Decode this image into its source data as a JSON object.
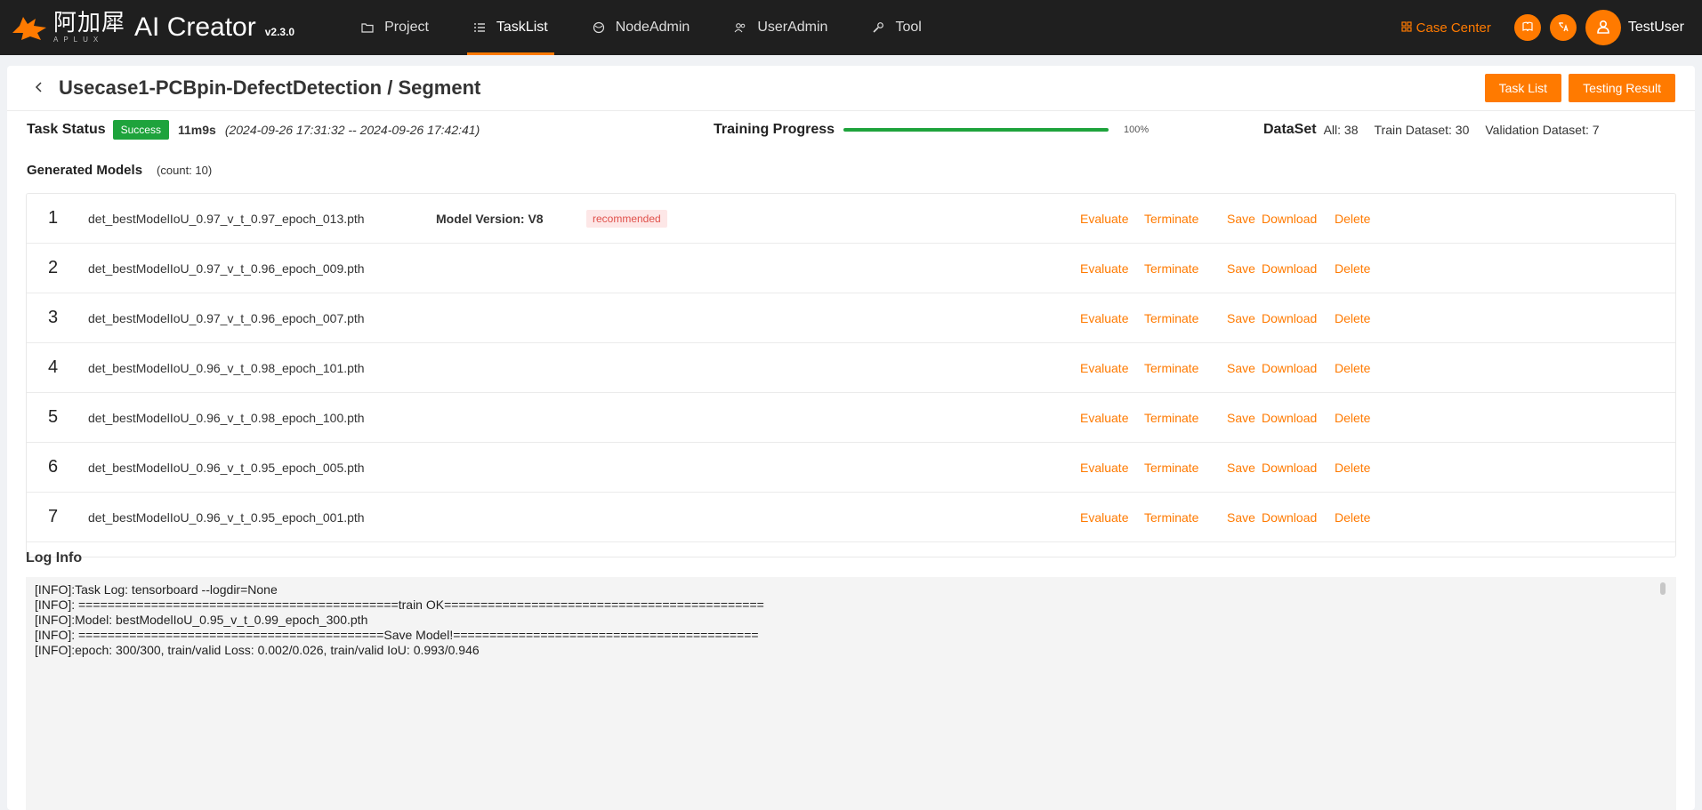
{
  "app": {
    "brand_cn": "阿加犀",
    "brand_en": "APLUX",
    "brand_name": "AI Creator",
    "version": "v2.3.0"
  },
  "nav": [
    {
      "label": "Project",
      "icon": "folder-icon",
      "active": false
    },
    {
      "label": "TaskList",
      "icon": "list-icon",
      "active": true
    },
    {
      "label": "NodeAdmin",
      "icon": "globe-icon",
      "active": false
    },
    {
      "label": "UserAdmin",
      "icon": "users-icon",
      "active": false
    },
    {
      "label": "Tool",
      "icon": "wrench-icon",
      "active": false
    }
  ],
  "topright": {
    "case_center": "Case Center",
    "username": "TestUser"
  },
  "page": {
    "title": "Usecase1-PCBpin-DefectDetection / Segment",
    "btn_task_list": "Task List",
    "btn_testing_result": "Testing Result"
  },
  "status": {
    "label": "Task Status",
    "badge": "Success",
    "duration": "11m9s",
    "time_range": "(2024-09-26 17:31:32 -- 2024-09-26 17:42:41)",
    "progress_label": "Training Progress",
    "progress_value": 100,
    "progress_text": "100%",
    "dataset_label": "DataSet",
    "dataset_all": "All: 38",
    "dataset_train": "Train Dataset: 30",
    "dataset_val": "Validation Dataset: 7"
  },
  "models": {
    "title": "Generated Models",
    "count": "(count:  10)",
    "version_label": "Model Version:  V8",
    "recommended": "recommended",
    "actions": {
      "evaluate": "Evaluate",
      "terminate": "Terminate",
      "save": "Save",
      "download": "Download",
      "delete": "Delete"
    },
    "rows": [
      {
        "idx": "1",
        "name": "det_bestModelIoU_0.97_v_t_0.97_epoch_013.pth"
      },
      {
        "idx": "2",
        "name": "det_bestModelIoU_0.97_v_t_0.96_epoch_009.pth"
      },
      {
        "idx": "3",
        "name": "det_bestModelIoU_0.97_v_t_0.96_epoch_007.pth"
      },
      {
        "idx": "4",
        "name": "det_bestModelIoU_0.96_v_t_0.98_epoch_101.pth"
      },
      {
        "idx": "5",
        "name": "det_bestModelIoU_0.96_v_t_0.98_epoch_100.pth"
      },
      {
        "idx": "6",
        "name": "det_bestModelIoU_0.96_v_t_0.95_epoch_005.pth"
      },
      {
        "idx": "7",
        "name": "det_bestModelIoU_0.96_v_t_0.95_epoch_001.pth"
      }
    ]
  },
  "log": {
    "title": "Log Info",
    "lines": [
      "[INFO]:Task Log: tensorboard --logdir=None",
      "[INFO]: ============================================train OK============================================",
      "[INFO]:Model: bestModelIoU_0.95_v_t_0.99_epoch_300.pth",
      "[INFO]: ==========================================Save Model!==========================================",
      "[INFO]:epoch: 300/300, train/valid Loss: 0.002/0.026, train/valid IoU: 0.993/0.946"
    ]
  }
}
